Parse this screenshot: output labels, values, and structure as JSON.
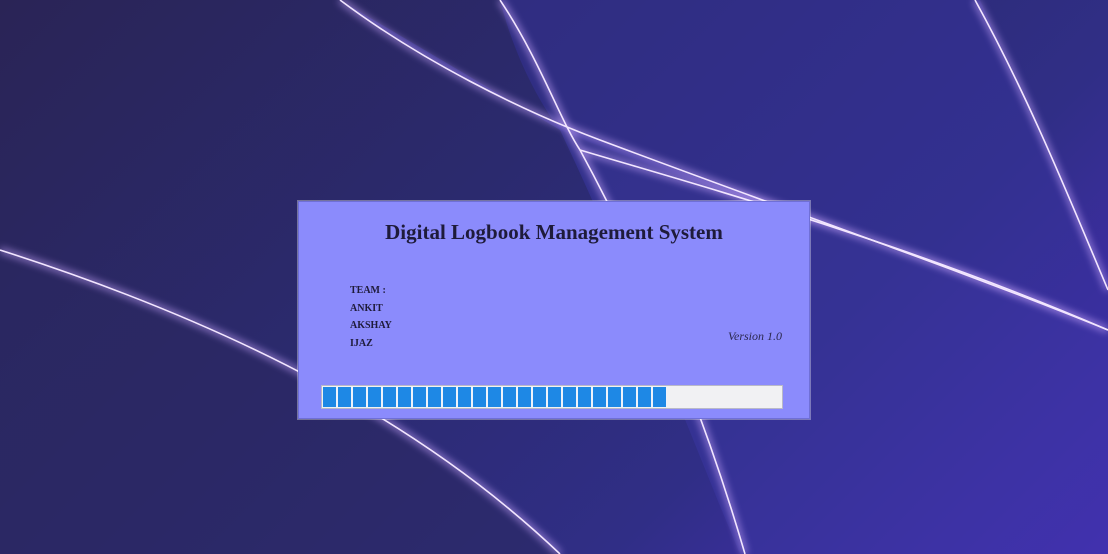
{
  "splash": {
    "title": "Digital Logbook Management System",
    "team_heading": "TEAM :",
    "team_members": [
      "ANKIT",
      "AKSHAY",
      "IJAZ"
    ],
    "version": "Version 1.0"
  },
  "progress": {
    "value_percent": 75
  },
  "colors": {
    "splash_background": "#8b8bfc",
    "progress_fill": "#1e88e5",
    "progress_track": "#f1f1f3",
    "title_text": "#1e1b3a"
  }
}
